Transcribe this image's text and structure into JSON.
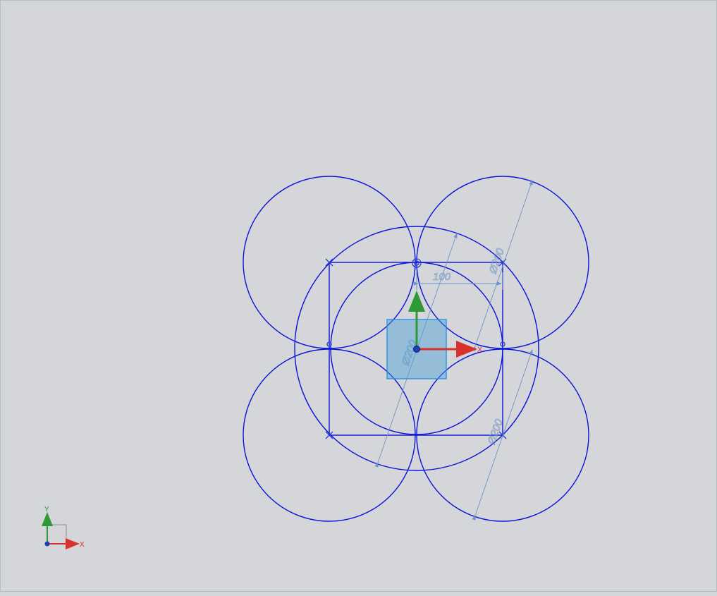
{
  "viewport": {
    "background": "#d4d6d9",
    "sketch_color": "#0a14d8",
    "dimension_color": "#6f93c6"
  },
  "dimensions": {
    "diameter_top_right": "Ø200",
    "diameter_bottom_right": "Ø200",
    "diameter_center": "Ø200",
    "horizontal_distance": "100"
  },
  "sketch_csys": {
    "x_label": "X",
    "x_color": "#d8322f",
    "y_color": "#2f9a35",
    "plane_color": "#4a9fd8"
  },
  "view_triad": {
    "x_label": "X",
    "y_label": "Y",
    "x_color": "#d8322f",
    "y_color": "#2f9a35"
  }
}
